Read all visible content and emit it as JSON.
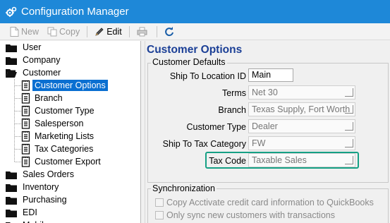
{
  "window": {
    "title": "Configuration Manager"
  },
  "toolbar": {
    "new_label": "New",
    "copy_label": "Copy",
    "edit_label": "Edit"
  },
  "tree": {
    "items": [
      {
        "label": "User",
        "icon": "folder-icon"
      },
      {
        "label": "Company",
        "icon": "folder-icon"
      },
      {
        "label": "Customer",
        "icon": "folder-open-icon"
      },
      {
        "label": "Customer Options",
        "icon": "config-doc-icon",
        "selected": true
      },
      {
        "label": "Branch",
        "icon": "config-doc-icon"
      },
      {
        "label": "Customer Type",
        "icon": "config-doc-icon"
      },
      {
        "label": "Salesperson",
        "icon": "config-doc-icon"
      },
      {
        "label": "Marketing Lists",
        "icon": "config-doc-icon"
      },
      {
        "label": "Tax Categories",
        "icon": "config-doc-icon"
      },
      {
        "label": "Customer Export",
        "icon": "config-doc-icon"
      },
      {
        "label": "Sales Orders",
        "icon": "folder-icon"
      },
      {
        "label": "Inventory",
        "icon": "folder-icon"
      },
      {
        "label": "Purchasing",
        "icon": "folder-icon"
      },
      {
        "label": "EDI",
        "icon": "folder-icon"
      },
      {
        "label": "Mobile",
        "icon": "folder-icon"
      }
    ]
  },
  "panel": {
    "title": "Customer Options",
    "defaults_group": {
      "legend": "Customer Defaults",
      "fields": [
        {
          "label": "Ship To Location ID",
          "value": "Main"
        },
        {
          "label": "Terms",
          "value": "Net 30"
        },
        {
          "label": "Branch",
          "value": "Texas Supply, Fort Worth"
        },
        {
          "label": "Customer Type",
          "value": "Dealer"
        },
        {
          "label": "Ship To Tax Category",
          "value": "FW"
        },
        {
          "label": "Tax Code",
          "value": "Taxable Sales"
        }
      ]
    },
    "sync_group": {
      "legend": "Synchronization",
      "options": [
        {
          "label": "Copy Acctivate credit card information to QuickBooks",
          "checked": false
        },
        {
          "label": "Only sync new customers with transactions",
          "checked": false
        }
      ]
    }
  },
  "colors": {
    "titlebar": "#1e88d8",
    "selection": "#0a6fd1",
    "panel_title": "#1b3f96",
    "highlight_border": "#16a085"
  }
}
